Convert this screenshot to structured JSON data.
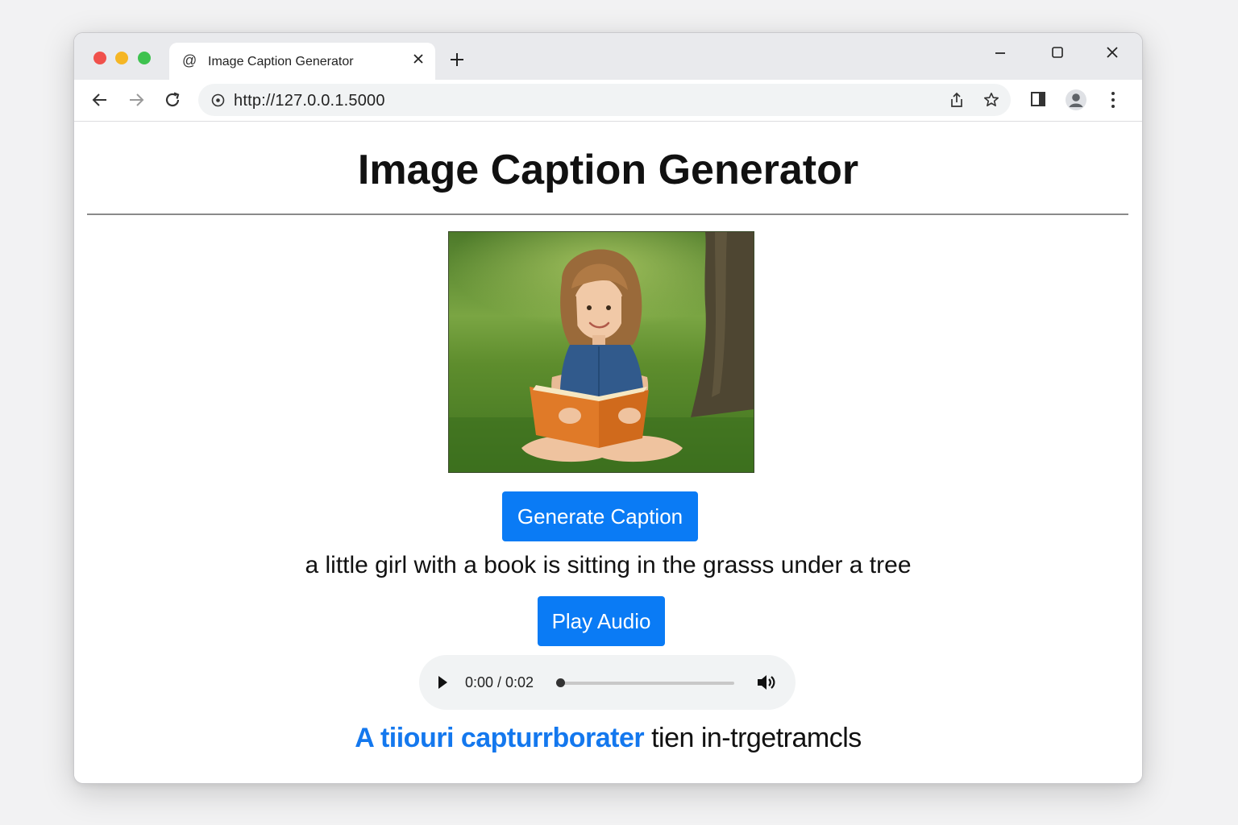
{
  "browser": {
    "tab": {
      "title": "Image Caption Generator",
      "favicon": "at-sign-icon"
    },
    "url": "http://127.0.0.1.5000"
  },
  "page": {
    "title": "Image Caption Generator",
    "image": {
      "subject": "girl-reading-book-on-grass",
      "alt": ""
    },
    "generate_button": "Generate Caption",
    "caption": "a little girl with a book is sitting in the grasss under  a  tree",
    "play_button": "Play Audio",
    "audio": {
      "time": "0:00 / 0:02",
      "progress": 0
    },
    "footer": {
      "blue": "A tiiouri capturrborater",
      "black": " tien in-trgetramcls"
    }
  },
  "colors": {
    "accent": "#0a7bf5",
    "footer_blue": "#1478ee",
    "traffic_red": "#f0514c",
    "traffic_yellow": "#f5b625",
    "traffic_green": "#3ec24f"
  }
}
